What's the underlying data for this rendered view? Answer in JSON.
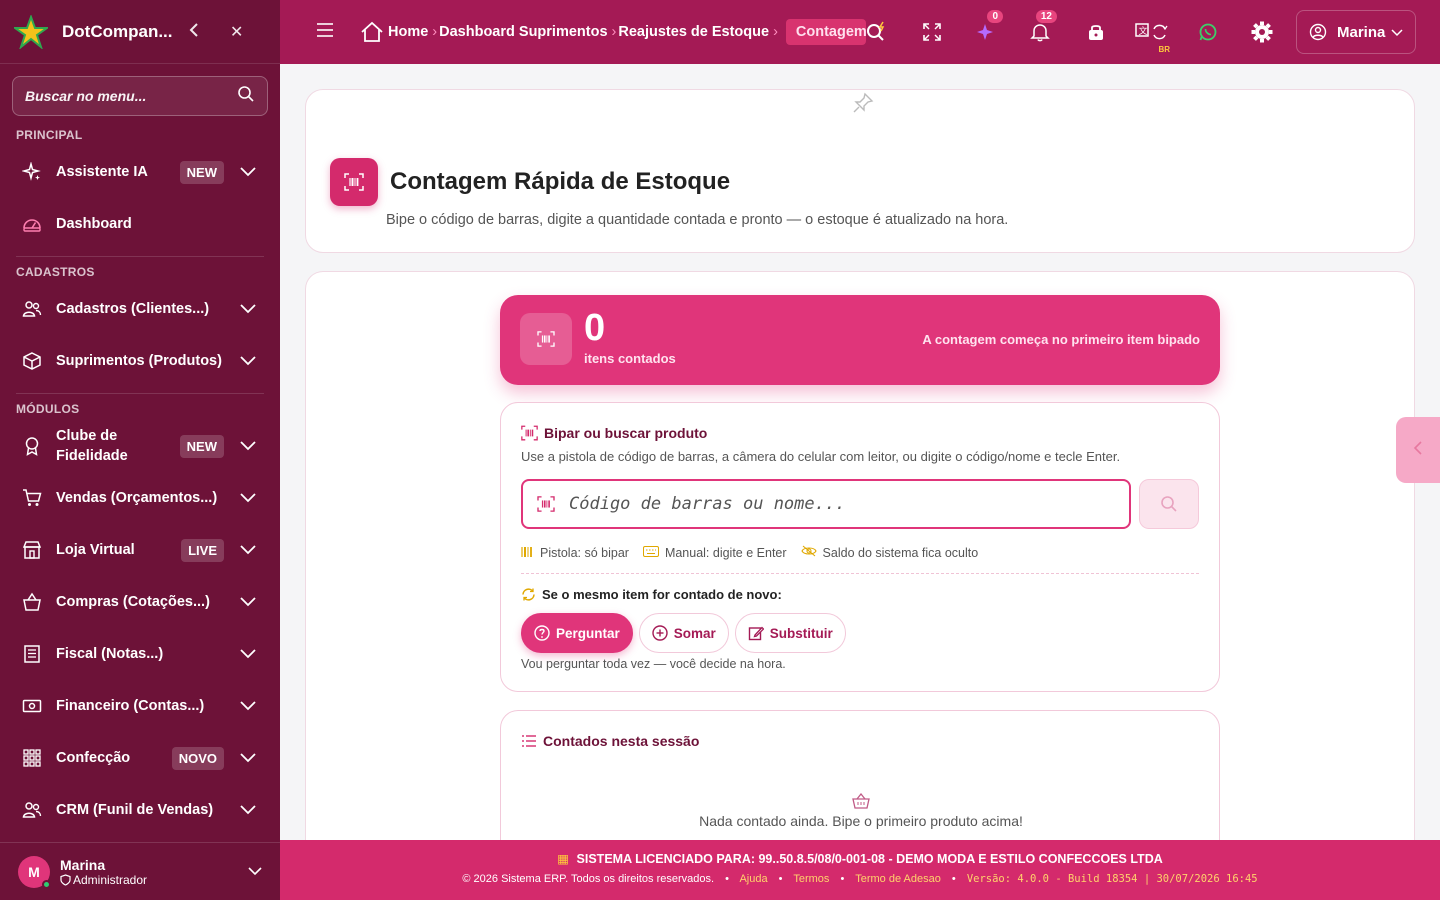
{
  "app": {
    "brand": "DotCompan..."
  },
  "sidebar": {
    "search_placeholder": "Buscar no menu...",
    "sections": {
      "principal": "PRINCIPAL",
      "cadastros": "CADASTROS",
      "modulos": "MÓDULOS"
    },
    "items": [
      {
        "label": "Assistente IA",
        "badge": "NEW"
      },
      {
        "label": "Dashboard",
        "badge": ""
      },
      {
        "label": "Cadastros (Clientes...)",
        "badge": ""
      },
      {
        "label": "Suprimentos (Produtos)",
        "badge": ""
      },
      {
        "label": "Clube de Fidelidade",
        "badge": "NEW"
      },
      {
        "label": "Vendas (Orçamentos...)",
        "badge": ""
      },
      {
        "label": "Loja Virtual",
        "badge": "LIVE"
      },
      {
        "label": "Compras (Cotações...)",
        "badge": ""
      },
      {
        "label": "Fiscal (Notas...)",
        "badge": ""
      },
      {
        "label": "Financeiro (Contas...)",
        "badge": ""
      },
      {
        "label": "Confecção",
        "badge": "NOVO"
      },
      {
        "label": "CRM (Funil de Vendas)",
        "badge": ""
      }
    ],
    "user": {
      "initial": "M",
      "name": "Marina",
      "role": "Administrador"
    }
  },
  "topbar": {
    "breadcrumb": [
      "Home",
      "Dashboard Suprimentos",
      "Reajustes de Estoque",
      "Contagem"
    ],
    "badges": {
      "ai": "0",
      "notifications": "12"
    },
    "lang_tag": "BR",
    "user_name": "Marina"
  },
  "page": {
    "title": "Contagem Rápida de Estoque",
    "subtitle": "Bipe o código de barras, digite a quantidade contada e pronto — o estoque é atualizado na hora."
  },
  "counter": {
    "value": "0",
    "label": "itens contados",
    "hint": "A contagem começa no primeiro item bipado"
  },
  "scan": {
    "title": "Bipar ou buscar produto",
    "description": "Use a pistola de código de barras, a câmera do celular com leitor, ou digite o código/nome e tecle Enter.",
    "placeholder": "Código de barras ou nome...",
    "hints": [
      "Pistola: só bipar",
      "Manual: digite e Enter",
      "Saldo do sistema fica oculto"
    ],
    "repeat_title": "Se o mesmo item for contado de novo:",
    "options": [
      "Perguntar",
      "Somar",
      "Substituir"
    ],
    "option_desc": "Vou perguntar toda vez — você decide na hora."
  },
  "session": {
    "title": "Contados nesta sessão",
    "empty": "Nada contado ainda. Bipe o primeiro produto acima!"
  },
  "footer": {
    "license": "SISTEMA LICENCIADO PARA: 99..50.8.5/08/0-001-08 - DEMO MODA E ESTILO CONFECCOES LTDA",
    "copyright": "© 2026 Sistema ERP. Todos os direitos reservados.",
    "links": [
      "Ajuda",
      "Termos",
      "Termo de Adesao"
    ],
    "version": "Versão: 4.0.0 - Build 18354 | 30/07/2026 16:45"
  },
  "colors": {
    "sidebar": "#6d1238",
    "topbar": "#a41a55",
    "accent": "#e0357a",
    "footer": "#d42a6c"
  }
}
